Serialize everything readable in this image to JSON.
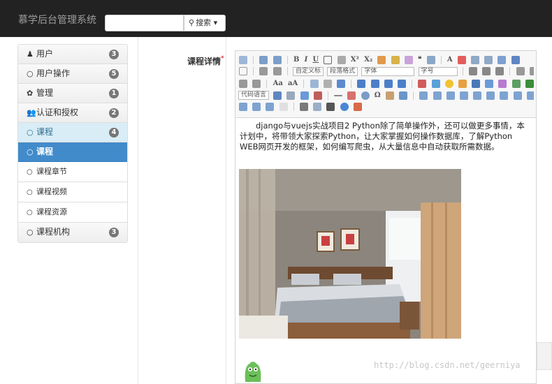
{
  "navbar": {
    "brand": "慕学后台管理系统",
    "search_value": "",
    "search_button": "搜索",
    "search_caret": "▾"
  },
  "sidebar": {
    "items": [
      {
        "icon": "user-icon",
        "glyph": "♟",
        "label": "用户",
        "badge": "3"
      },
      {
        "icon": "circle-icon",
        "glyph": "○",
        "label": "用户操作",
        "badge": "5"
      },
      {
        "icon": "gear-icon",
        "glyph": "✿",
        "label": "管理",
        "badge": "1"
      },
      {
        "icon": "group-icon",
        "glyph": "👥",
        "label": "认证和授权",
        "badge": "2"
      },
      {
        "icon": "circle-icon",
        "glyph": "○",
        "label": "课程",
        "badge": "4"
      }
    ],
    "active": {
      "glyph": "○",
      "label": "课程"
    },
    "subitems": [
      {
        "glyph": "○",
        "label": "课程章节"
      },
      {
        "glyph": "○",
        "label": "课程视频"
      },
      {
        "glyph": "○",
        "label": "课程资源"
      }
    ],
    "last": {
      "glyph": "○",
      "label": "课程机构",
      "badge": "3"
    }
  },
  "form": {
    "label": "课程详情",
    "required_mark": "*"
  },
  "editor": {
    "toolbar": {
      "row2_dropdowns": [
        "自定义标",
        "段落格式",
        "字体",
        "字号"
      ],
      "row4_dropdown": "代码语言"
    },
    "content": "django与vuejs实战项目2 Python除了简单操作外，还可以做更多事情，本计划中，将带领大家探索Python，让大家掌握如何操作数据库，了解Python WEB网页开发的框架，如何编写爬虫，从大量信息中自动获取所需数据。"
  },
  "watermark": "http://blog.csdn.net/geerniya",
  "colors": {
    "navbar": "#222222",
    "active_item": "#428bca",
    "selected_parent": "#d9edf7",
    "badge": "#777777"
  }
}
